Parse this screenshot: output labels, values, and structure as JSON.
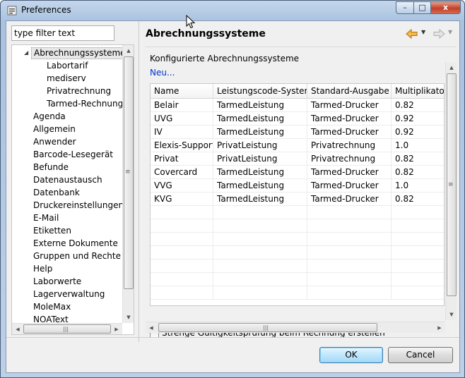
{
  "window": {
    "title": "Preferences"
  },
  "sidebar": {
    "filter_placeholder": "type filter text",
    "items": [
      {
        "label": "Abrechnungssysteme",
        "level": 0,
        "selected": true,
        "expanded": true
      },
      {
        "label": "Labortarif",
        "level": 1
      },
      {
        "label": "mediserv",
        "level": 1
      },
      {
        "label": "Privatrechnung",
        "level": 1
      },
      {
        "label": "Tarmed-Rechnungen",
        "level": 1
      },
      {
        "label": "Agenda",
        "level": 0
      },
      {
        "label": "Allgemein",
        "level": 0
      },
      {
        "label": "Anwender",
        "level": 0
      },
      {
        "label": "Barcode-Lesegerät",
        "level": 0
      },
      {
        "label": "Befunde",
        "level": 0
      },
      {
        "label": "Datenaustausch",
        "level": 0
      },
      {
        "label": "Datenbank",
        "level": 0
      },
      {
        "label": "Druckereinstellungen",
        "level": 0
      },
      {
        "label": "E-Mail",
        "level": 0
      },
      {
        "label": "Etiketten",
        "level": 0
      },
      {
        "label": "Externe Dokumente",
        "level": 0
      },
      {
        "label": "Gruppen und Rechte",
        "level": 0
      },
      {
        "label": "Help",
        "level": 0
      },
      {
        "label": "Laborwerte",
        "level": 0
      },
      {
        "label": "Lagerverwaltung",
        "level": 0
      },
      {
        "label": "MoleMax",
        "level": 0
      },
      {
        "label": "NOAText",
        "level": 0
      }
    ]
  },
  "page": {
    "title": "Abrechnungssysteme",
    "section_label": "Konfigurierte Abrechnungssysteme",
    "new_link": "Neu...",
    "table": {
      "columns": [
        "Name",
        "Leistungscode-System",
        "Standard-Ausgabe",
        "Multiplikator"
      ],
      "rows": [
        [
          "Belair",
          "TarmedLeistung",
          "Tarmed-Drucker",
          "0.82"
        ],
        [
          "UVG",
          "TarmedLeistung",
          "Tarmed-Drucker",
          "0.92"
        ],
        [
          "IV",
          "TarmedLeistung",
          "Tarmed-Drucker",
          "0.92"
        ],
        [
          "Elexis-Support",
          "PrivatLeistung",
          "Privatrechnung",
          "1.0"
        ],
        [
          "Privat",
          "PrivatLeistung",
          "Privatrechnung",
          "0.82"
        ],
        [
          "Covercard",
          "TarmedLeistung",
          "Tarmed-Drucker",
          "0.82"
        ],
        [
          "VVG",
          "TarmedLeistung",
          "Tarmed-Drucker",
          "1.0"
        ],
        [
          "KVG",
          "TarmedLeistung",
          "Tarmed-Drucker",
          "0.82"
        ]
      ]
    },
    "checkbox_label": "Strenge Gültigkeitsprüfung beim Rechnung erstellen",
    "checkbox_checked": false
  },
  "buttons": {
    "ok": "OK",
    "cancel": "Cancel"
  },
  "caption_buttons": {
    "minimize": "–",
    "maximize": "□",
    "close": "x"
  },
  "icons": {
    "scroll_up": "▲",
    "scroll_down": "▼",
    "scroll_left": "◀",
    "scroll_right": "▶",
    "grip_vertical": "≡",
    "grip_horizontal": "|||",
    "dropdown": "▼",
    "expanded": "◢"
  },
  "colors": {
    "link": "#0033cc",
    "nav_back": "#e8a020",
    "nav_forward": "#c0c0c0"
  }
}
